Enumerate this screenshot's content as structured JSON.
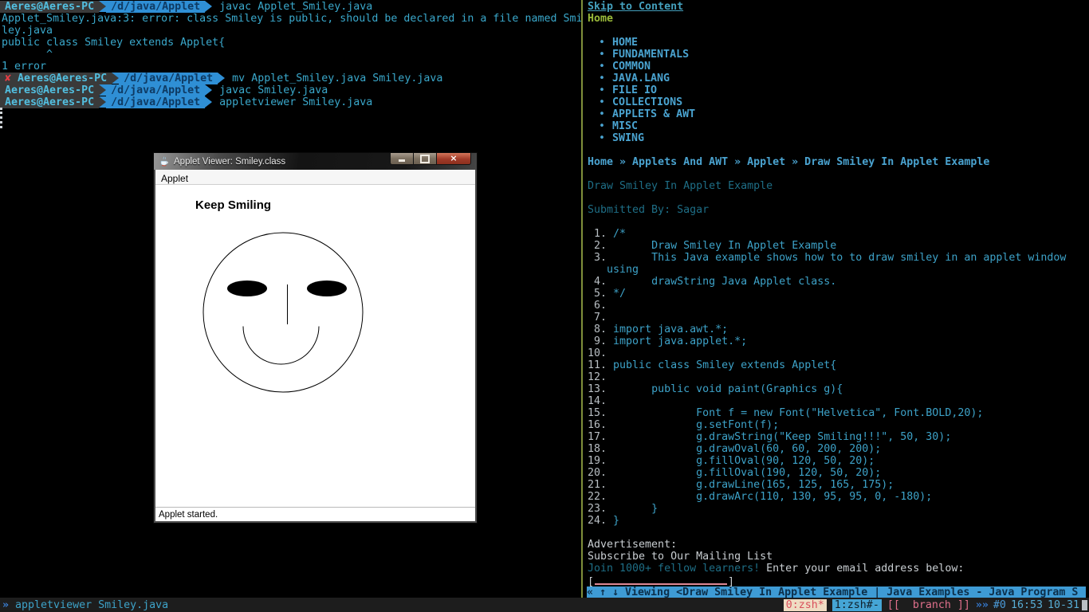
{
  "terminal": {
    "prompts": [
      {
        "mark": "",
        "user": "Aeres@Aeres-PC",
        "path": "/d/java/Applet",
        "command": "javac Applet_Smiley.java"
      },
      {
        "mark": "✘ ",
        "user": "Aeres@Aeres-PC",
        "path": "/d/java/Applet",
        "command": "mv Applet_Smiley.java Smiley.java"
      },
      {
        "mark": "",
        "user": "Aeres@Aeres-PC",
        "path": "/d/java/Applet",
        "command": "javac Smiley.java"
      },
      {
        "mark": "",
        "user": "Aeres@Aeres-PC",
        "path": "/d/java/Applet",
        "command": "appletviewer Smiley.java"
      }
    ],
    "output": {
      "error_line1": "Applet_Smiley.java:3: error: class Smiley is public, should be declared in a file named Smi",
      "error_line2": "ley.java",
      "error_source": "public class Smiley extends Applet{",
      "caret_line": "       ^",
      "error_count": "1 error"
    }
  },
  "applet_window": {
    "title": "Applet Viewer: Smiley.class",
    "menu_item": "Applet",
    "canvas_text": "Keep Smiling",
    "status": "Applet started.",
    "controls": {
      "minimize_icon": "–",
      "maximize_icon": "□",
      "close_icon": "×"
    }
  },
  "browser": {
    "skip_link": "Skip to Content",
    "home_link": "Home",
    "nav_bullet": "•",
    "nav_items": [
      "HOME",
      "FUNDAMENTALS",
      "COMMON",
      "JAVA.LANG",
      "FILE IO",
      "COLLECTIONS",
      "APPLETS & AWT",
      "MISC",
      "SWING"
    ],
    "breadcrumb": "Home » Applets And AWT » Applet » Draw Smiley In Applet Example",
    "page_title": "Draw Smiley In Applet Example",
    "submitted_by": "Submitted By: Sagar",
    "code_lines": [
      {
        "n": " 1.",
        "c": " /*"
      },
      {
        "n": " 2.",
        "c": "       Draw Smiley In Applet Example"
      },
      {
        "n": " 3.",
        "c": "       This Java example shows how to to draw smiley in an applet window"
      },
      {
        "n": "",
        "c": "   using"
      },
      {
        "n": " 4.",
        "c": "       drawString Java Applet class."
      },
      {
        "n": " 5.",
        "c": " */"
      },
      {
        "n": " 6.",
        "c": ""
      },
      {
        "n": " 7.",
        "c": ""
      },
      {
        "n": " 8.",
        "c": " import java.awt.*;"
      },
      {
        "n": " 9.",
        "c": " import java.applet.*;"
      },
      {
        "n": "10.",
        "c": ""
      },
      {
        "n": "11.",
        "c": " public class Smiley extends Applet{"
      },
      {
        "n": "12.",
        "c": ""
      },
      {
        "n": "13.",
        "c": "       public void paint(Graphics g){"
      },
      {
        "n": "14.",
        "c": ""
      },
      {
        "n": "15.",
        "c": "              Font f = new Font(\"Helvetica\", Font.BOLD,20);"
      },
      {
        "n": "16.",
        "c": "              g.setFont(f);"
      },
      {
        "n": "17.",
        "c": "              g.drawString(\"Keep Smiling!!!\", 50, 30);"
      },
      {
        "n": "18.",
        "c": "              g.drawOval(60, 60, 200, 200);"
      },
      {
        "n": "19.",
        "c": "              g.fillOval(90, 120, 50, 20);"
      },
      {
        "n": "20.",
        "c": "              g.fillOval(190, 120, 50, 20);"
      },
      {
        "n": "21.",
        "c": "              g.drawLine(165, 125, 165, 175);"
      },
      {
        "n": "22.",
        "c": "              g.drawArc(110, 130, 95, 95, 0, -180);"
      },
      {
        "n": "23.",
        "c": "       }"
      },
      {
        "n": "24.",
        "c": " }"
      }
    ],
    "ad_label": "Advertisement:",
    "subscribe_heading": "Subscribe to Our Mailing List",
    "join_text": "Join 1000+ fellow learners!",
    "email_prompt": " Enter your email address below:",
    "email_bracket_open": "[",
    "email_bracket_close": "]",
    "statusbar_text": "« ↑ ↓ Viewing <Draw Smiley In Applet Example | Java Examples - Java Program S"
  },
  "tmux": {
    "left_chevron": "»",
    "left_text": " appletviewer Smiley.java",
    "window0": "0:zsh*",
    "window1": "1:zsh#-",
    "branch": "[[  branch ]]",
    "chevrons": "»»",
    "session": "#0",
    "time": "16:53",
    "date": "10-31"
  },
  "colors": {
    "link_blue": "#4aa3d0",
    "dim_teal": "#1e6e86",
    "terminal_cyan": "#3aa8cb",
    "home_green": "#9aba3a",
    "divider_olive": "#7f8f3a",
    "statusbar_blue": "#3e9bd5",
    "prompt_blue": "#2f8fd5",
    "prompt_gray": "#3a3a3a",
    "error_red": "#e33e44",
    "email_pink": "#de8895"
  }
}
